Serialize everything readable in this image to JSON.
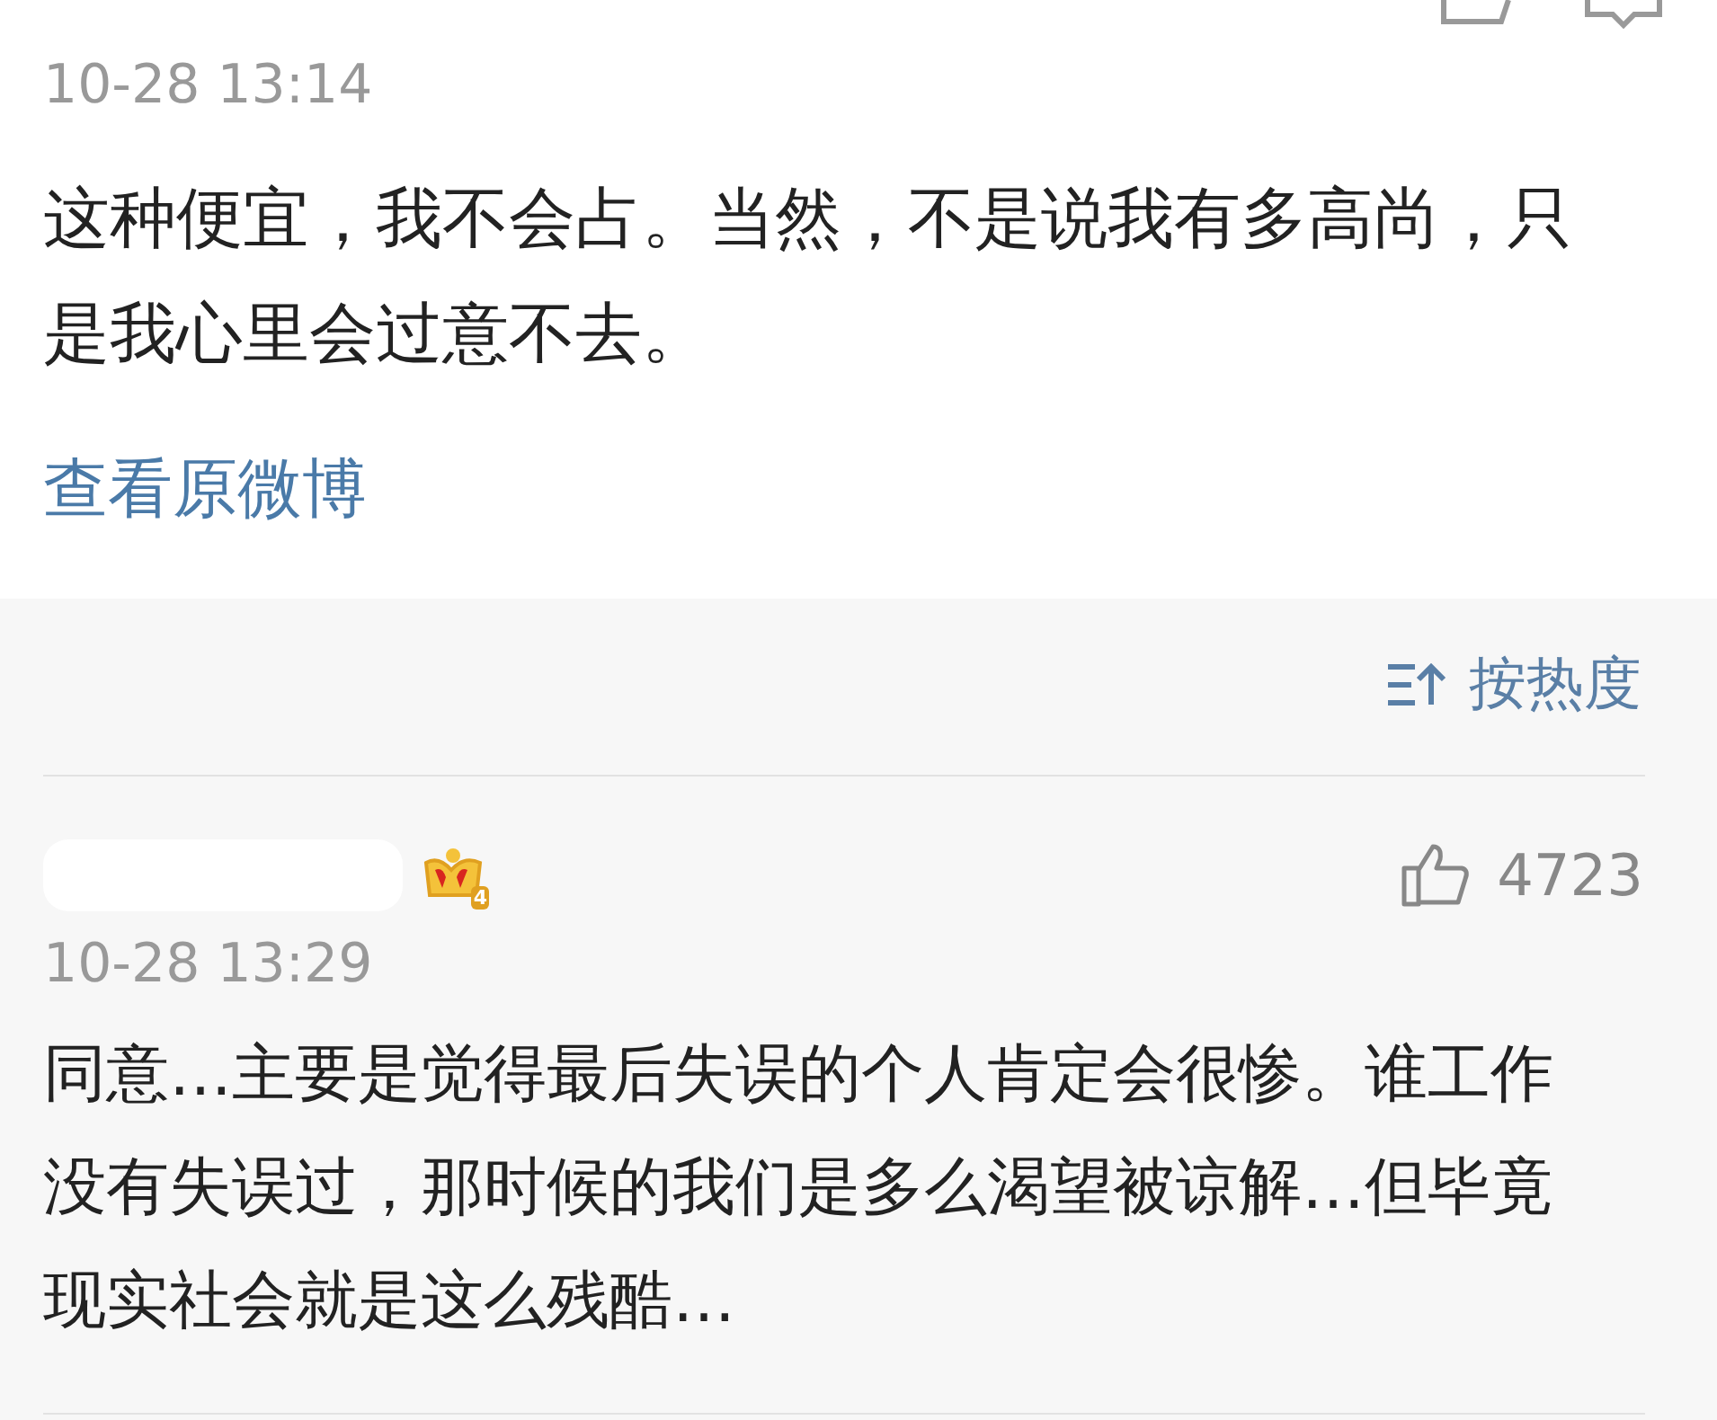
{
  "post": {
    "time": "10-28 13:14",
    "text": "这种便宜，我不会占。当然，不是说我有多高尚，只是我心里会过意不去。",
    "link": "查看原微博"
  },
  "sort": {
    "label": "按热度"
  },
  "comments": [
    {
      "badge_level": "4",
      "likes": "4723",
      "time": "10-28 13:29",
      "text": "同意…主要是觉得最后失误的个人肯定会很惨。谁工作没有失误过，那时候的我们是多么渴望被谅解…但毕竟现实社会就是这么残酷…"
    }
  ]
}
